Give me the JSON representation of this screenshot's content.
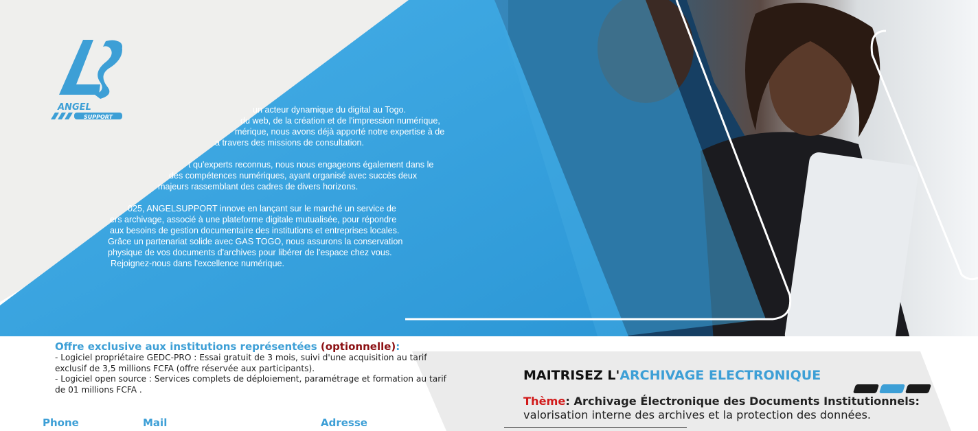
{
  "brand": {
    "logo_text": "ANGEL",
    "logo_subtext": "SUPPORT"
  },
  "about": {
    "lines": [
      "un acteur dynamique du digital au Togo.",
      "du web, de la création et de l'impression numérique,",
      "mérique, nous avons déjà apporté notre expertise à de",
      "a travers des missions de consultation.",
      "t qu'experts reconnus, nous nous engageons également dans le",
      "des compétences numériques, ayant organisé avec succès deux",
      "majeurs rassemblant des cadres de divers horizons.",
      "025, ANGELSUPPORT innove en lançant sur le marché un service de",
      "ers archivage, associé à une plateforme digitale mutualisée, pour répondre",
      "aux besoins de gestion documentaire des institutions et entreprises locales.",
      "Grâce un partenariat solide avec GAS TOGO, nous assurons la conservation",
      "physique de vos documents d'archives pour libérer de l'espace chez vous.",
      "Rejoignez-nous dans l'excellence numérique."
    ]
  },
  "offer": {
    "title": "Offre exclusive aux institutions représentées",
    "optional": "(optionnelle)",
    "colon": ":",
    "items": [
      "- Logiciel propriétaire GEDC-PRO : Essai gratuit de 3 mois, suivi d'une acquisition au tarif exclusif de 3,5 millions FCFA (offre réservée aux participants).",
      "- Logiciel open source : Services complets de déploiement, paramétrage et formation au tarif de 01 millions FCFA ."
    ]
  },
  "contacts": {
    "phone_label": "Phone",
    "mail_label": "Mail",
    "address_label": "Adresse"
  },
  "headline": {
    "prefix": "MAITRISEZ L'",
    "accent": "ARCHIVAGE ELECTRONIQUE"
  },
  "theme": {
    "label": "Thème",
    "colon": ":",
    "title": " Archivage Électronique  des Documents Institutionnels:",
    "subtitle": "valorisation interne des archives et la protection des données."
  },
  "colors": {
    "accent_blue": "#3d9fd6",
    "dark_blue": "#1f6fa8",
    "light_gray": "#efefed",
    "red": "#d11a1a",
    "dark_red": "#8b0f12"
  }
}
